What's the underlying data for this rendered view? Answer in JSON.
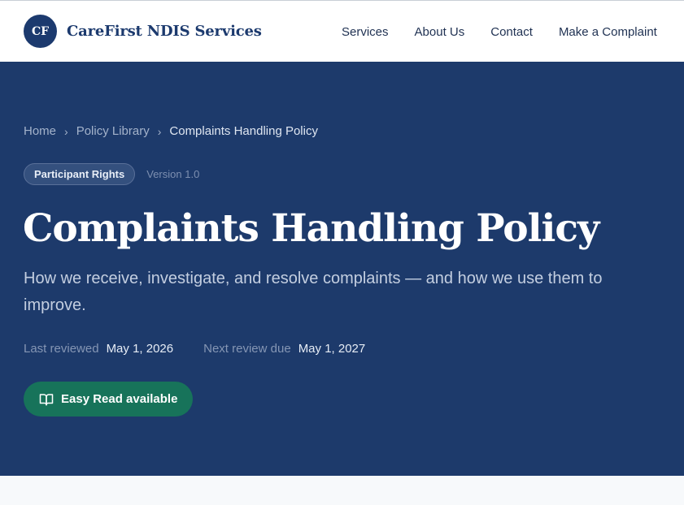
{
  "header": {
    "logo_text": "CF",
    "brand_name": "CareFirst NDIS Services",
    "nav": [
      {
        "label": "Services"
      },
      {
        "label": "About Us"
      },
      {
        "label": "Contact"
      },
      {
        "label": "Make a Complaint"
      }
    ]
  },
  "breadcrumb": {
    "items": [
      {
        "label": "Home"
      },
      {
        "label": "Policy Library"
      }
    ],
    "separator": "›",
    "current": "Complaints Handling Policy"
  },
  "hero": {
    "badge": "Participant Rights",
    "version": "Version 1.0",
    "title": "Complaints Handling Policy",
    "subtitle": "How we receive, investigate, and resolve complaints — and how we use them to improve.",
    "last_reviewed_label": "Last reviewed",
    "last_reviewed_value": "May 1, 2026",
    "next_review_label": "Next review due",
    "next_review_value": "May 1, 2027",
    "easy_read_label": "Easy Read available",
    "easy_read_icon": "book-open-icon"
  },
  "colors": {
    "brand_navy": "#1c3a6e",
    "hero_background": "#1d3a6b",
    "easy_read_green": "#17735a",
    "header_background": "#ffffff"
  }
}
